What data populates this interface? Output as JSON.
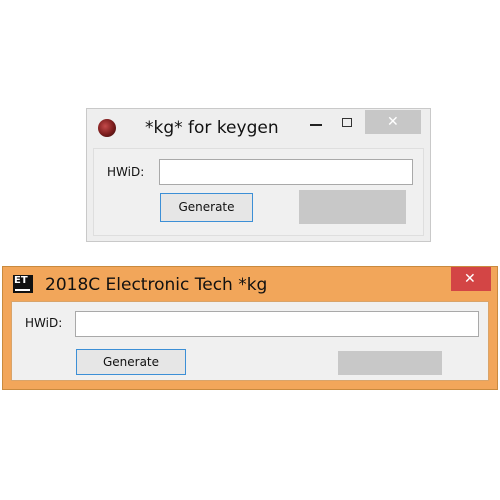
{
  "windows": [
    {
      "title": "*kg* for keygen",
      "icon": "app-icon",
      "controls": {
        "minimize": "minimize-icon",
        "maximize": "maximize-icon",
        "close": "✕"
      },
      "hwid_label": "HWiD:",
      "hwid_value": "",
      "generate_label": "Generate"
    },
    {
      "title": "2018C Electronic Tech *kg",
      "icon_text": "ET",
      "controls": {
        "close": "✕"
      },
      "hwid_label": "HWiD:",
      "hwid_value": "",
      "generate_label": "Generate",
      "accent_color": "#f2a65a",
      "close_color": "#d34545"
    }
  ]
}
